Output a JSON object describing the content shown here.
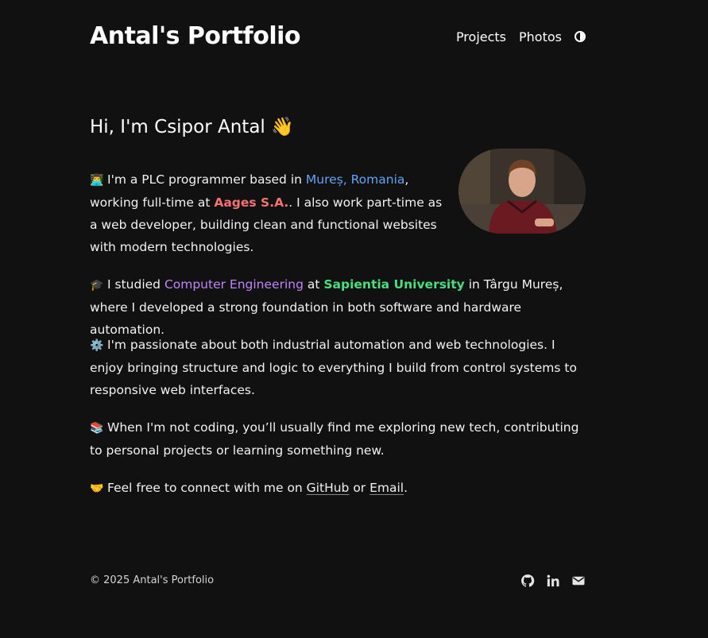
{
  "header": {
    "site_title": "Antal's Portfolio",
    "nav": {
      "projects": "Projects",
      "photos": "Photos"
    },
    "theme_icon": "half-circle-contrast-icon"
  },
  "intro": {
    "title": "Hi, I'm Csipor Antal 👋",
    "avatar_icon": "profile-photo"
  },
  "paragraphs": {
    "p1": {
      "emoji": "👨‍💻",
      "t1": "I'm a PLC programmer based in ",
      "location": "Mureș, Romania",
      "t2": ", working full-time at ",
      "company": "Aages S.A.",
      "t3": ". I also work part-time as a web developer, building clean and functional websites with modern technologies."
    },
    "p2": {
      "emoji": "🎓",
      "t1": "I studied ",
      "field": "Computer Engineering",
      "t2": " at ",
      "university": "Sapientia University",
      "t3": " in Târgu Mureș, where I developed a strong foundation in both software and hardware automation."
    },
    "p3": {
      "emoji": "⚙️",
      "text": "I'm passionate about both industrial automation and web technologies. I enjoy bringing structure and logic to everything I build from control systems to responsive web interfaces."
    },
    "p4": {
      "emoji": "📚",
      "text": "When I'm not coding, you’ll usually find me exploring new tech, contributing to personal projects or learning something new."
    },
    "p5": {
      "emoji": "🤝",
      "t1": "Feel free to connect with me on ",
      "github": "GitHub",
      "t2": " or ",
      "email": "Email",
      "t3": "."
    }
  },
  "footer": {
    "copyright": "© 2025 Antal's Portfolio",
    "icons": [
      "github-icon",
      "linkedin-icon",
      "mail-icon"
    ]
  },
  "colors": {
    "background": "#111111",
    "text": "#f2f2f2",
    "blue": "#60a5fa",
    "red": "#f87171",
    "purple": "#c084fc",
    "green": "#4ade80"
  }
}
